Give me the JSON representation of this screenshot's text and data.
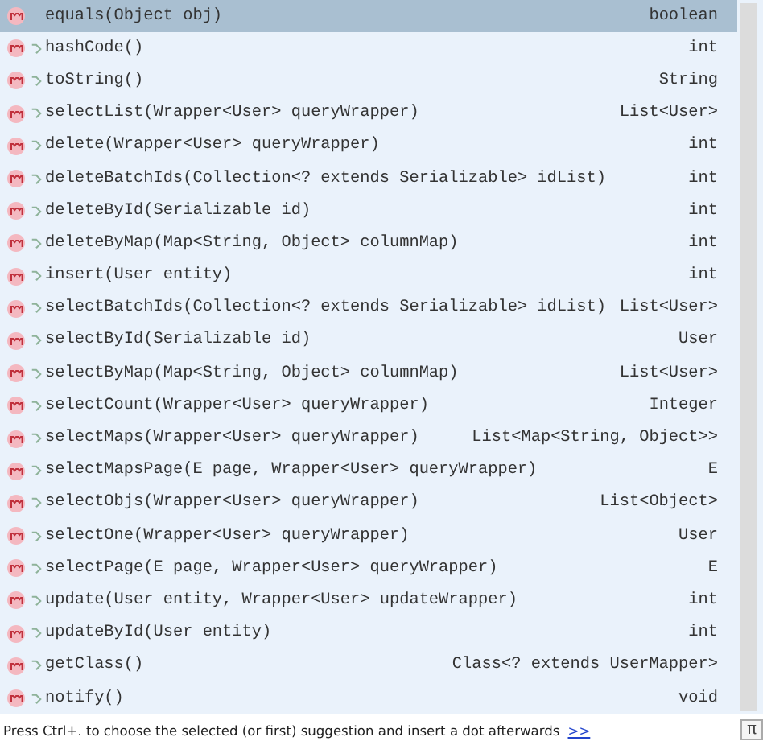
{
  "items": [
    {
      "name": "equals(Object obj)",
      "type": "boolean",
      "selected": true,
      "public": false
    },
    {
      "name": "hashCode()",
      "type": "int",
      "selected": false,
      "public": true
    },
    {
      "name": "toString()",
      "type": "String",
      "selected": false,
      "public": true
    },
    {
      "name": "selectList(Wrapper<User> queryWrapper)",
      "type": "List<User>",
      "selected": false,
      "public": true
    },
    {
      "name": "delete(Wrapper<User> queryWrapper)",
      "type": "int",
      "selected": false,
      "public": true
    },
    {
      "name": "deleteBatchIds(Collection<? extends Serializable> idList)",
      "type": "int",
      "selected": false,
      "public": true
    },
    {
      "name": "deleteById(Serializable id)",
      "type": "int",
      "selected": false,
      "public": true
    },
    {
      "name": "deleteByMap(Map<String, Object> columnMap)",
      "type": "int",
      "selected": false,
      "public": true
    },
    {
      "name": "insert(User entity)",
      "type": "int",
      "selected": false,
      "public": true
    },
    {
      "name": "selectBatchIds(Collection<? extends Serializable> idList)",
      "type": "List<User>",
      "selected": false,
      "public": true
    },
    {
      "name": "selectById(Serializable id)",
      "type": "User",
      "selected": false,
      "public": true
    },
    {
      "name": "selectByMap(Map<String, Object> columnMap)",
      "type": "List<User>",
      "selected": false,
      "public": true
    },
    {
      "name": "selectCount(Wrapper<User> queryWrapper)",
      "type": "Integer",
      "selected": false,
      "public": true
    },
    {
      "name": "selectMaps(Wrapper<User> queryWrapper)",
      "type": "List<Map<String, Object>>",
      "selected": false,
      "public": true
    },
    {
      "name": "selectMapsPage(E page, Wrapper<User> queryWrapper)",
      "type": "E",
      "selected": false,
      "public": true
    },
    {
      "name": "selectObjs(Wrapper<User> queryWrapper)",
      "type": "List<Object>",
      "selected": false,
      "public": true
    },
    {
      "name": "selectOne(Wrapper<User> queryWrapper)",
      "type": "User",
      "selected": false,
      "public": true
    },
    {
      "name": "selectPage(E page, Wrapper<User> queryWrapper)",
      "type": "E",
      "selected": false,
      "public": true
    },
    {
      "name": "update(User entity, Wrapper<User> updateWrapper)",
      "type": "int",
      "selected": false,
      "public": true
    },
    {
      "name": "updateById(User entity)",
      "type": "int",
      "selected": false,
      "public": true
    },
    {
      "name": "getClass()",
      "type": "Class<? extends UserMapper>",
      "selected": false,
      "public": true
    },
    {
      "name": "notify()",
      "type": "void",
      "selected": false,
      "public": true
    }
  ],
  "footer": {
    "hint": "Press Ctrl+. to choose the selected (or first) suggestion and insert a dot afterwards",
    "link": ">>",
    "corner": "π"
  }
}
